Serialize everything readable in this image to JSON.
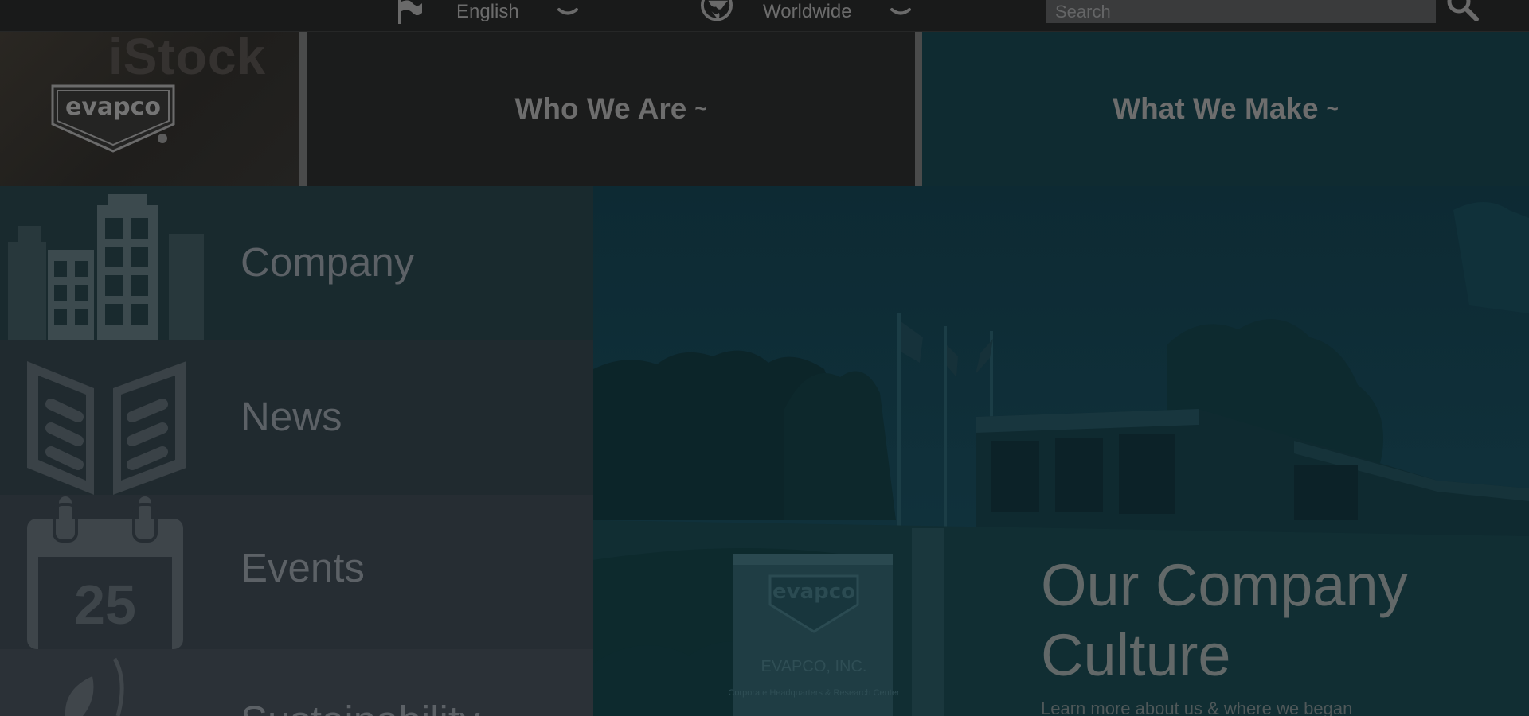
{
  "topbar": {
    "language": {
      "label": "English",
      "icon": "flag-icon"
    },
    "region": {
      "label": "Worldwide",
      "icon": "globe-icon"
    },
    "search": {
      "placeholder": "Search",
      "icon": "search-icon"
    }
  },
  "header": {
    "logo_text": "evapco",
    "watermark_text": "iStock",
    "nav": [
      {
        "label": "Who We Are",
        "suffix": "~"
      },
      {
        "label": "What We Make",
        "suffix": "~"
      }
    ]
  },
  "menu": {
    "items": [
      {
        "label": "Company",
        "icon": "buildings-icon"
      },
      {
        "label": "News",
        "icon": "open-book-icon"
      },
      {
        "label": "Events",
        "icon": "calendar-icon",
        "icon_text": "25"
      },
      {
        "label": "Sustainability",
        "icon": "leaf-icon"
      }
    ]
  },
  "hero": {
    "title": "Our Company Culture",
    "subtitle": "Learn more about us & where we began",
    "sign_name": "EVAPCO, INC.",
    "sign_sub": "Corporate Headquarters & Research Center"
  },
  "colors": {
    "teal": "#0f2b31",
    "overlay": "#161819"
  }
}
